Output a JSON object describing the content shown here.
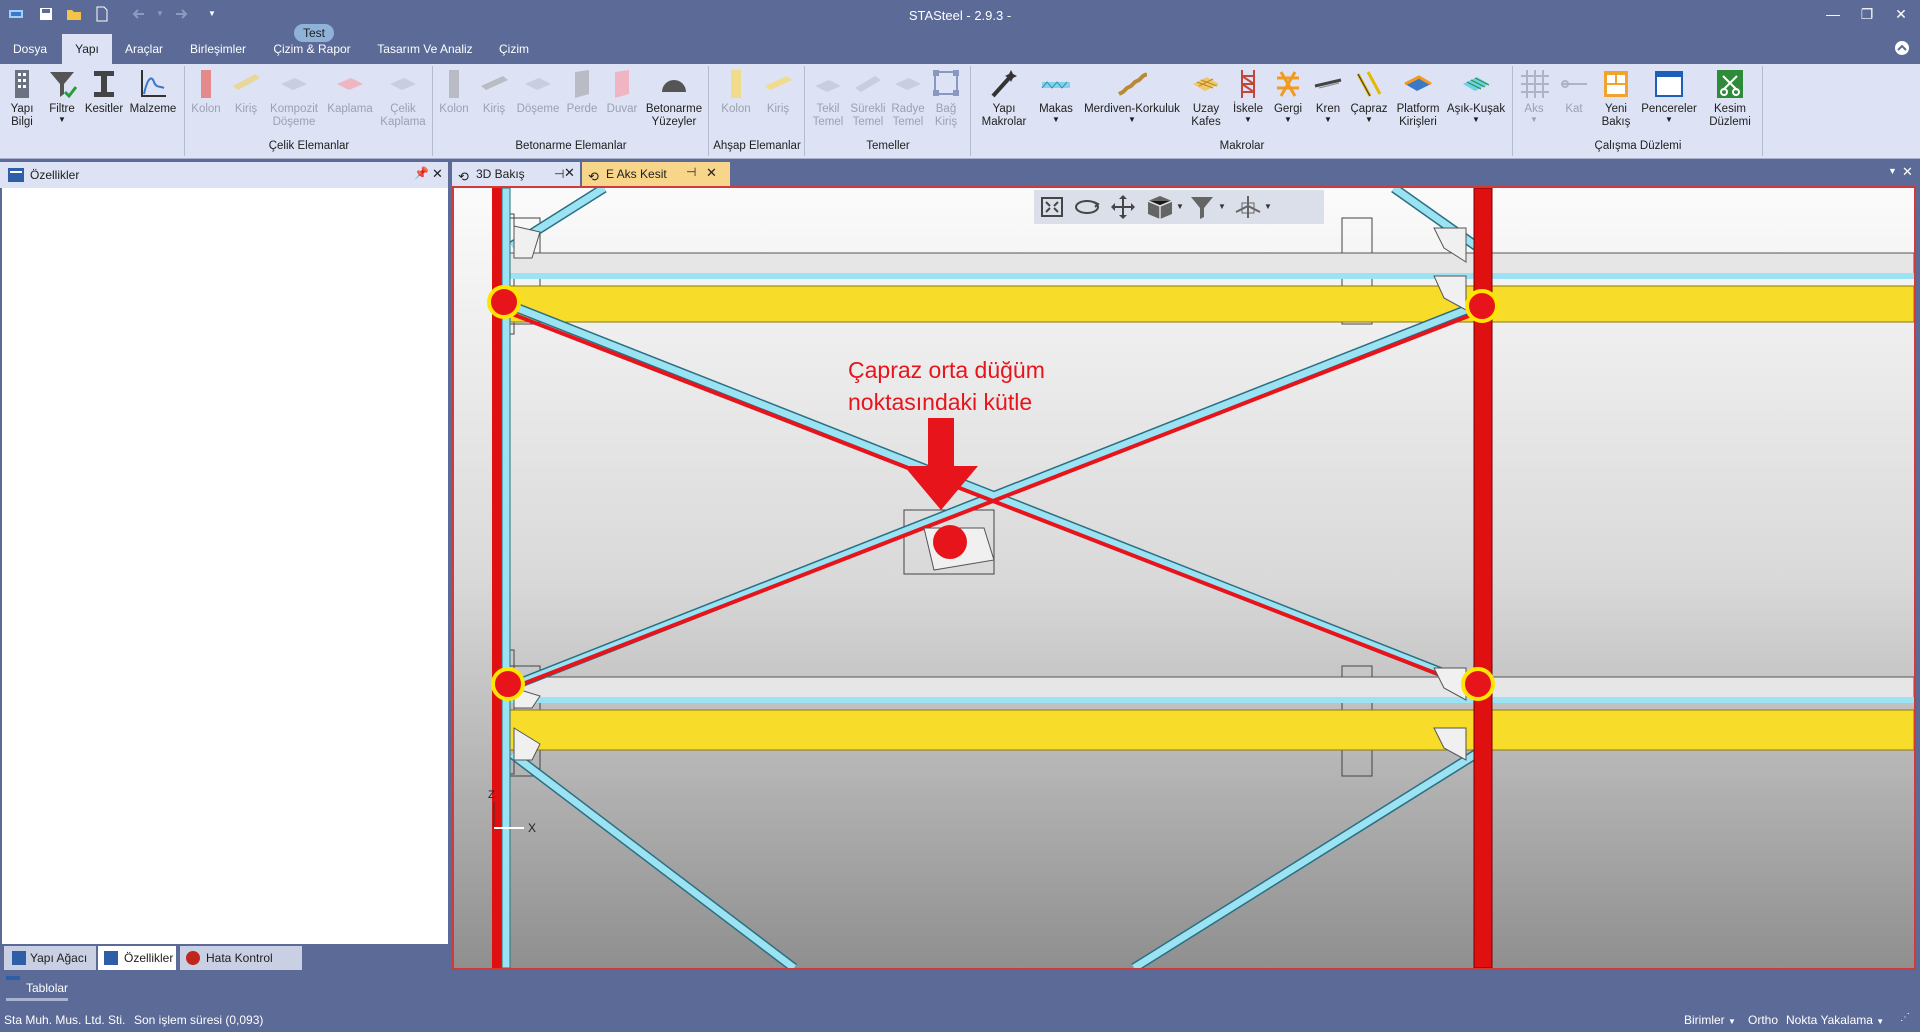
{
  "app": {
    "title": "STASteel - 2.9.3 -"
  },
  "ribbon_tabs": {
    "dosya": "Dosya",
    "yapi": "Yapı",
    "araclar": "Araçlar",
    "birlesimler": "Birleşimler",
    "cizim_rapor": "Çizim & Rapor",
    "tasarim": "Tasarım Ve Analiz",
    "cizim": "Çizim",
    "context_badge": "Test"
  },
  "ribbon": {
    "general": {
      "yapi_bilgi": "Yapı\nBilgi",
      "filtre": "Filtre",
      "kesitler": "Kesitler",
      "malzeme": "Malzeme"
    },
    "celik": {
      "label": "Çelik Elemanlar",
      "kolon": "Kolon",
      "kiris": "Kiriş",
      "kompozit": "Kompozit\nDöşeme",
      "kaplama": "Kaplama",
      "celik_kaplama": "Çelik\nKaplama"
    },
    "betonarme": {
      "label": "Betonarme Elemanlar",
      "kolon": "Kolon",
      "kiris": "Kiriş",
      "doseme": "Döşeme",
      "perde": "Perde",
      "duvar": "Duvar",
      "yuzeyler": "Betonarme\nYüzeyler"
    },
    "ahsap": {
      "label": "Ahşap Elemanlar",
      "kolon": "Kolon",
      "kiris": "Kiriş"
    },
    "temeller": {
      "label": "Temeller",
      "tekil": "Tekil\nTemel",
      "surekli": "Sürekli\nTemel",
      "radye": "Radye\nTemel",
      "bag": "Bağ\nKiriş"
    },
    "makrolar": {
      "label": "Makrolar",
      "yapi_makrolar": "Yapı\nMakrolar",
      "makas": "Makas",
      "merdiven": "Merdiven-Korkuluk",
      "uzay": "Uzay\nKafes",
      "iskele": "İskele",
      "gergi": "Gergi",
      "kren": "Kren",
      "capraz": "Çapraz",
      "platform": "Platform\nKirişleri",
      "asik": "Aşık-Kuşak"
    },
    "calisma": {
      "label": "Çalışma Düzlemi",
      "aks": "Aks",
      "kat": "Kat",
      "yeni_bakis": "Yeni\nBakış",
      "pencereler": "Pencereler",
      "kesim": "Kesim\nDüzlemi"
    }
  },
  "left_panel": {
    "title": "Özellikler",
    "tabs": [
      "Yapı Ağacı",
      "Özellikler",
      "Hata Kontrol"
    ]
  },
  "doc_tabs": [
    "3D Bakış",
    "E Aks Kesit"
  ],
  "viewport": {
    "annotation_line1": "Çapraz orta düğüm",
    "annotation_line2": "noktasındaki kütle",
    "axis_z": "Z",
    "axis_x": "X",
    "colors": {
      "column": "#e01010",
      "beam": "#f7dc2a",
      "brace": "#9be3f2",
      "mass": "#e8141c",
      "mass_ring": "#ffe600"
    }
  },
  "bottom": {
    "tablolar": "Tablolar"
  },
  "status": {
    "company": "Sta Muh. Mus. Ltd. Sti.",
    "last_op": "Son işlem süresi (0,093)",
    "birimler": "Birimler",
    "ortho": "Ortho",
    "nokta": "Nokta Yakalama"
  }
}
